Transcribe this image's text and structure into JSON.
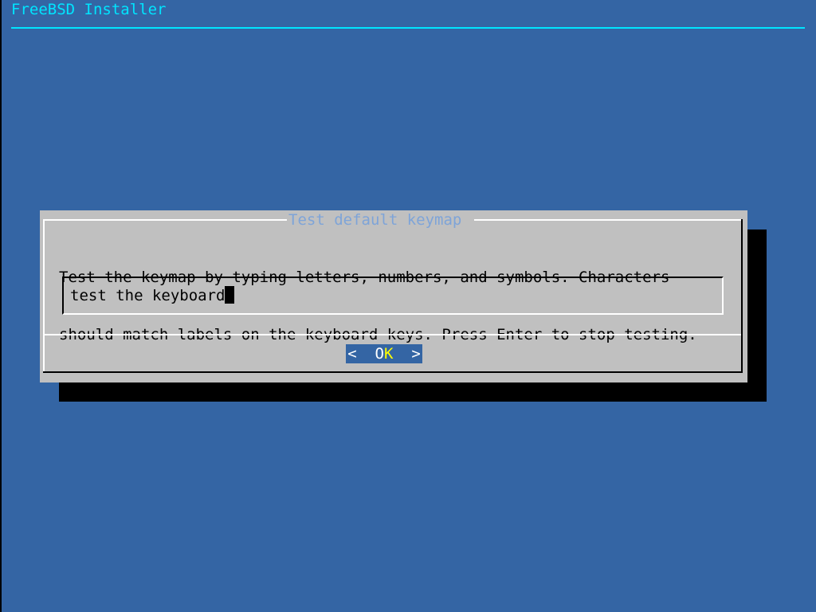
{
  "app": {
    "backtitle": "FreeBSD Installer"
  },
  "dialog": {
    "title": "Test default keymap",
    "message_line1": "Test the keymap by typing letters, numbers, and symbols. Characters",
    "message_line2": "should match labels on the keyboard keys. Press Enter to stop testing.",
    "input_value": "test the keyboard",
    "ok_button": {
      "left_bracket": "<",
      "label_first": "O",
      "label_hotkey": "K",
      "right_bracket": ">"
    }
  },
  "colors": {
    "background": "#3465a4",
    "backtitle": "#00e5ff",
    "dialog": "#c0c0c0",
    "dialog_title": "#7ea4d8",
    "button_bg": "#3465a4",
    "hotkey": "#ffff00"
  }
}
